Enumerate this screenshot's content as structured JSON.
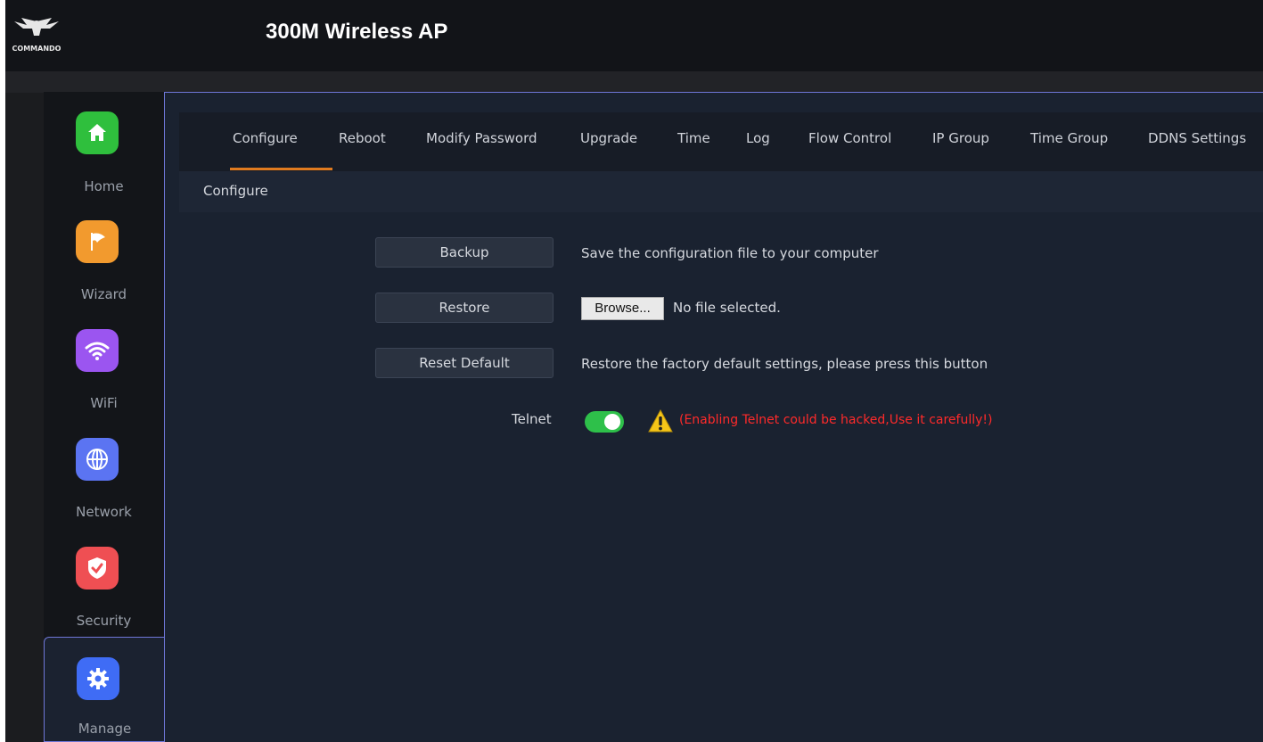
{
  "header": {
    "logo_text": "COMMANDO",
    "title": "300M Wireless AP"
  },
  "sidebar": {
    "items": [
      {
        "label": "Home",
        "icon": "home-icon",
        "color": "#2fbf3d"
      },
      {
        "label": "Wizard",
        "icon": "flag-icon",
        "color": "#f29a2e"
      },
      {
        "label": "WiFi",
        "icon": "wifi-icon",
        "color": "#9b55f0"
      },
      {
        "label": "Network",
        "icon": "globe-icon",
        "color": "#5b74f2"
      },
      {
        "label": "Security",
        "icon": "shield-icon",
        "color": "#ef4f53"
      },
      {
        "label": "Manage",
        "icon": "gear-icon",
        "color": "#3f6cf5"
      }
    ],
    "active": "Manage"
  },
  "tabs": [
    "Configure",
    "Reboot",
    "Modify Password",
    "Upgrade",
    "Time",
    "Log",
    "Flow Control",
    "IP Group",
    "Time Group",
    "DDNS Settings"
  ],
  "active_tab": "Configure",
  "section": {
    "title": "Configure"
  },
  "actions": {
    "backup": {
      "label": "Backup",
      "description": "Save the configuration file to your computer"
    },
    "restore": {
      "label": "Restore",
      "browse_label": "Browse...",
      "file_status": "No file selected."
    },
    "reset": {
      "label": "Reset Default",
      "description": "Restore the factory default settings, please press this button"
    }
  },
  "telnet": {
    "label": "Telnet",
    "enabled": true,
    "warning": "(Enabling Telnet could be hacked,Use it carefully!)"
  },
  "colors": {
    "accent_underline": "#e07b1f",
    "active_border": "#6f77d8",
    "toggle_on": "#2ec04a",
    "warning_text": "#ff2a2a"
  }
}
